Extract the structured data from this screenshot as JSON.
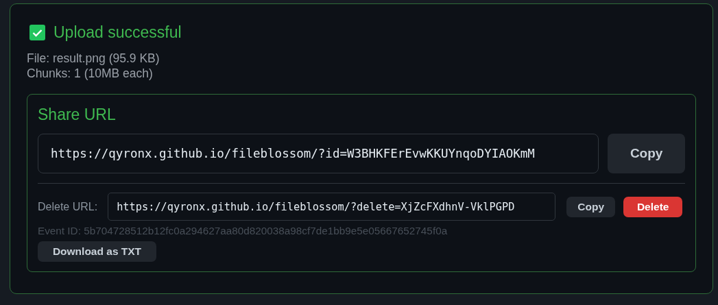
{
  "status": {
    "title": "Upload successful",
    "checked": true
  },
  "details": [
    "File: result.png (95.9 KB)",
    "Chunks: 1 (10MB each)"
  ],
  "share": {
    "title": "Share URL",
    "url": "https://qyronx.github.io/fileblossom/?id=W3BHKFErEvwKKUYnqoDYIAOKmM",
    "copy_button": "Copy",
    "delete_label": "Delete URL:",
    "delete_url": "https://qyronx.github.io/fileblossom/?delete=XjZcFXdhnV-VklPGPD",
    "delete_copy_button": "Copy",
    "delete_button": "Delete",
    "event_id": "Event ID: 5b704728512b12fc0a294627aa80d820038a98cf7de1bb9e5e05667652745f0a",
    "download_button": "Download as TXT"
  }
}
